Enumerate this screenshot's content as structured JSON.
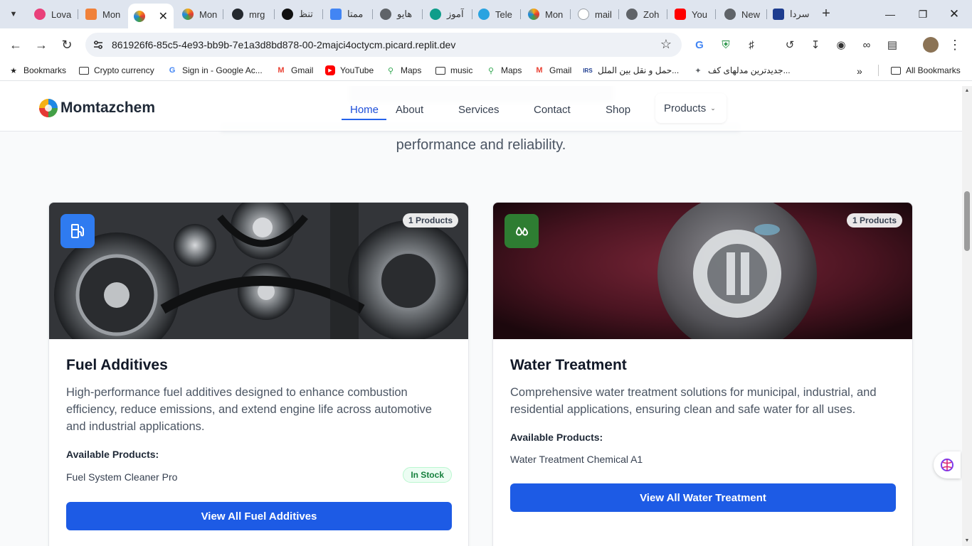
{
  "browser": {
    "tabs": [
      {
        "title": "Lova",
        "color": "#e9407a"
      },
      {
        "title": "Mon",
        "color": "#f0813a"
      },
      {
        "title": "",
        "color": "#f5b014",
        "active": true
      },
      {
        "title": "Mon",
        "color": "#f5b014"
      },
      {
        "title": "mrg",
        "color": "#24292f"
      },
      {
        "title": "تنظ",
        "color": "#111111"
      },
      {
        "title": "ممتا",
        "color": "#4285f4"
      },
      {
        "title": "هایو",
        "color": "#5f6368"
      },
      {
        "title": "آموز",
        "color": "#0f9d8a"
      },
      {
        "title": "Tele",
        "color": "#2aa3e0"
      },
      {
        "title": "Mon",
        "color": "#f5b014"
      },
      {
        "title": "mail",
        "color": "#9aa0a6"
      },
      {
        "title": "Zoh",
        "color": "#5f6368"
      },
      {
        "title": "You",
        "color": "#ff0000"
      },
      {
        "title": "New",
        "color": "#5f6368"
      },
      {
        "title": "سردا",
        "color": "#1d3c8f"
      }
    ],
    "url": "861926f6-85c5-4e93-bb9b-7e1a3d8bd878-00-2majci4octycm.picard.replit.dev",
    "bookmarks": [
      {
        "label": "Bookmarks",
        "icon": "star-icon"
      },
      {
        "label": "Crypto currency",
        "icon": "folder-icon"
      },
      {
        "label": "Sign in - Google Ac...",
        "icon": "google-icon"
      },
      {
        "label": "Gmail",
        "icon": "gmail-icon"
      },
      {
        "label": "YouTube",
        "icon": "youtube-icon"
      },
      {
        "label": "Maps",
        "icon": "maps-icon"
      },
      {
        "label": "music",
        "icon": "folder-icon"
      },
      {
        "label": "Maps",
        "icon": "maps-icon"
      },
      {
        "label": "Gmail",
        "icon": "gmail-icon"
      },
      {
        "label": "حمل و نقل بین الملل...",
        "icon": "site-icon"
      },
      {
        "label": "جدیدترین مدلهای کف...",
        "icon": "site-icon"
      }
    ],
    "all_bookmarks": "All Bookmarks"
  },
  "site": {
    "brand": "Momtazchem",
    "nav": {
      "home": "Home",
      "about": "About",
      "services": "Services",
      "contact": "Contact",
      "shop": "Shop",
      "products": "Products"
    },
    "subtitle": "performance and reliability."
  },
  "cards": [
    {
      "title": "Fuel Additives",
      "count": "1 Products",
      "description": "High-performance fuel additives designed to enhance combustion efficiency, reduce emissions, and extend engine life across automotive and industrial applications.",
      "available_label": "Available Products:",
      "product": "Fuel System Cleaner Pro",
      "stock": "In Stock",
      "button": "View All Fuel Additives",
      "icon": "fuel-pump-icon",
      "icon_color": "#2563eb"
    },
    {
      "title": "Water Treatment",
      "count": "1 Products",
      "description": "Comprehensive water treatment solutions for municipal, industrial, and residential applications, ensuring clean and safe water for all uses.",
      "available_label": "Available Products:",
      "product": "Water Treatment Chemical A1",
      "button": "View All Water Treatment",
      "icon": "droplets-icon",
      "icon_color": "#2e7d32"
    }
  ],
  "colors": {
    "primary": "#1d5be5",
    "stock_green": "#15803d"
  }
}
